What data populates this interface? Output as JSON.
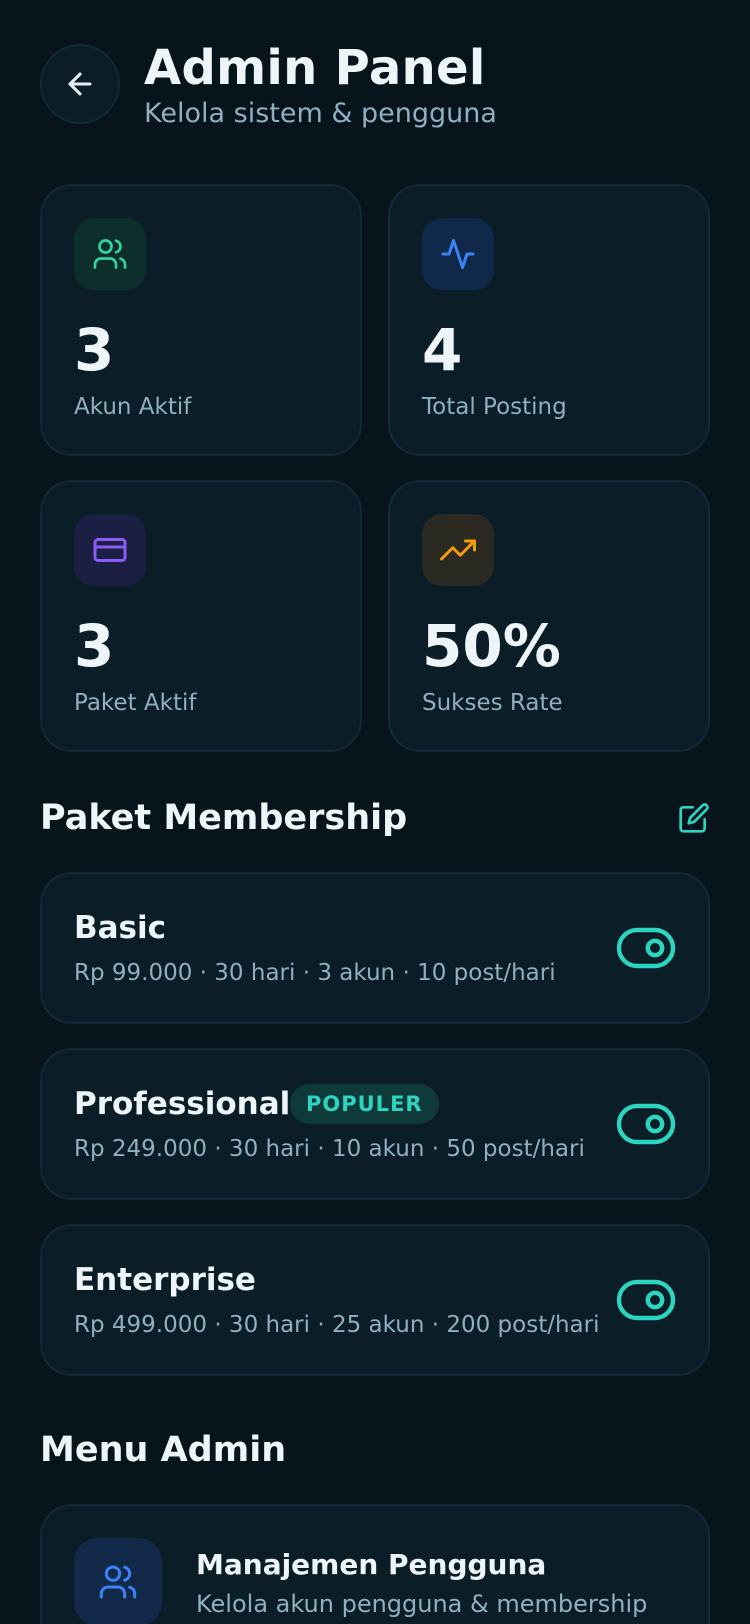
{
  "header": {
    "title": "Admin Panel",
    "subtitle": "Kelola sistem & pengguna",
    "back_icon": "arrow-left-icon"
  },
  "stats": [
    {
      "value": "3",
      "label": "Akun Aktif",
      "icon": "users-icon",
      "accent": "#34d399"
    },
    {
      "value": "4",
      "label": "Total Posting",
      "icon": "activity-icon",
      "accent": "#3b82f6"
    },
    {
      "value": "3",
      "label": "Paket Aktif",
      "icon": "credit-card-icon",
      "accent": "#8b5cf6"
    },
    {
      "value": "50%",
      "label": "Sukses Rate",
      "icon": "trending-up-icon",
      "accent": "#f59e0b"
    }
  ],
  "membership": {
    "title": "Paket Membership",
    "edit_icon": "edit-icon",
    "plans": [
      {
        "name": "Basic",
        "desc": "Rp 99.000 · 30 hari · 3 akun · 10 post/hari",
        "badge": "",
        "active": true
      },
      {
        "name": "Professional",
        "desc": "Rp 249.000 · 30 hari · 10 akun · 50 post/hari",
        "badge": "POPULER",
        "active": true
      },
      {
        "name": "Enterprise",
        "desc": "Rp 499.000 · 30 hari · 25 akun · 200 post/hari",
        "badge": "",
        "active": true
      }
    ]
  },
  "admin_menu": {
    "title": "Menu Admin",
    "items": [
      {
        "title": "Manajemen Pengguna",
        "desc": "Kelola akun pengguna & membership",
        "icon": "users-icon"
      }
    ]
  },
  "colors": {
    "background": "#07141c",
    "card": "#0b1d27",
    "accent": "#2dd4bf",
    "text_muted": "#8fb0c0"
  }
}
